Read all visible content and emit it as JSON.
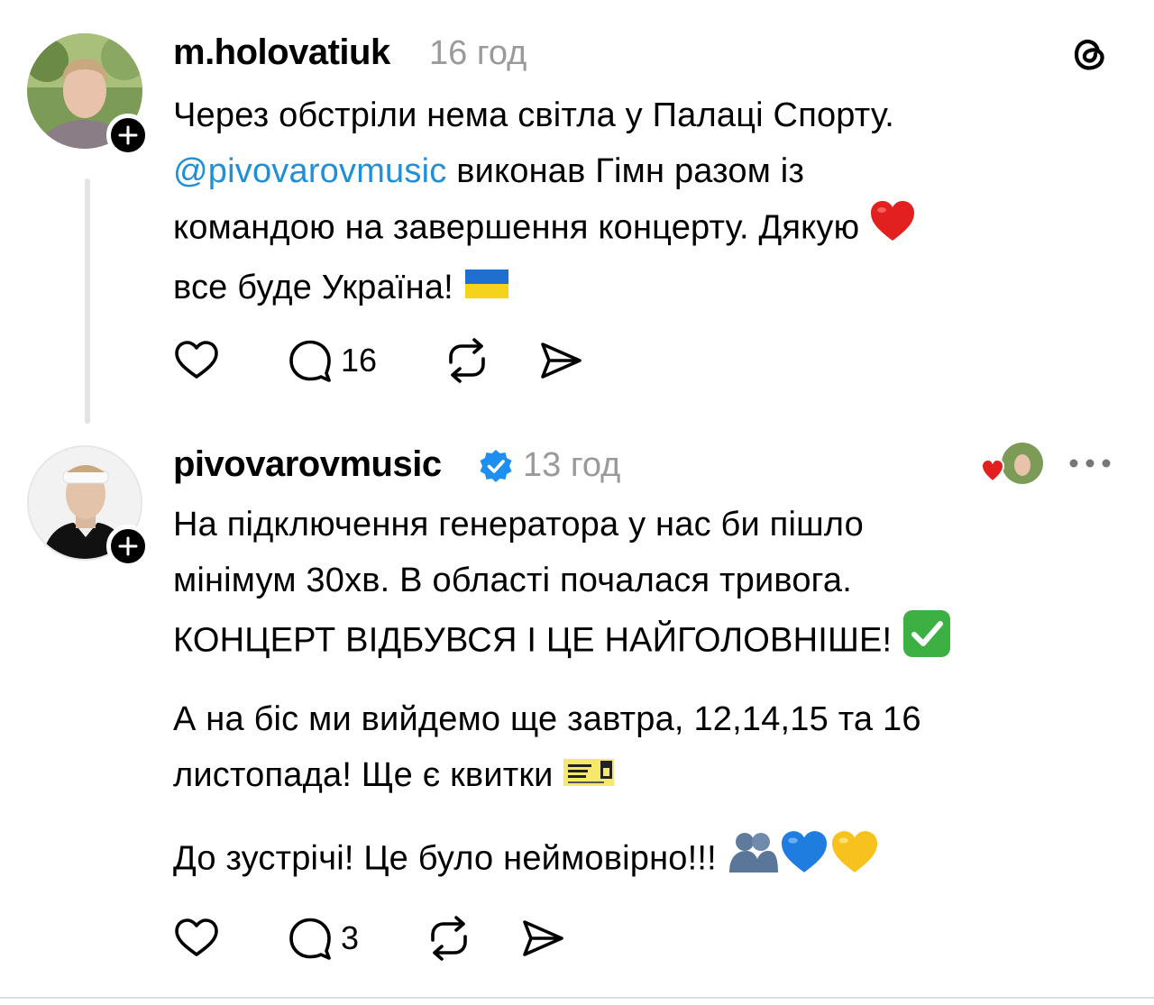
{
  "post1": {
    "username": "m.holovatiuk",
    "time": "16 год",
    "text_line1": "Через обстріли нема світла у Палаці Спорту.",
    "mention": "@pivovarovmusic",
    "text_line2_rest": " виконав Гімн разом із",
    "text_line3": "командою на завершення концерту. Дякую ",
    "text_line4": "все буде Україна! ",
    "reply_count": "16",
    "icons": [
      "heart-icon",
      "comment-icon",
      "repost-icon",
      "share-icon",
      "threads-logo-icon"
    ]
  },
  "post2": {
    "username": "pivovarovmusic",
    "time": "13 год",
    "para1_line1": "На підключення генератора у нас би пішло",
    "para1_line2": "мінімум 30хв. В області почалася тривога.",
    "para1_line3": "КОНЦЕРТ ВІДБУВСЯ  І ЦЕ НАЙГОЛОВНІШЕ! ",
    "para2_line1": "А на біс ми вийдемо ще завтра, 12,14,15 та 16",
    "para2_line2": "листопада! Ще є квитки ",
    "para3": "До зустрічі! Це було неймовірно!!! ",
    "reply_count": "3",
    "icons": [
      "heart-icon",
      "comment-icon",
      "repost-icon",
      "share-icon",
      "verified-badge-icon",
      "more-icon"
    ]
  },
  "colors": {
    "mention": "#1f8fd8",
    "verified": "#1e8ff0",
    "timestamp": "#9a9a9a"
  }
}
